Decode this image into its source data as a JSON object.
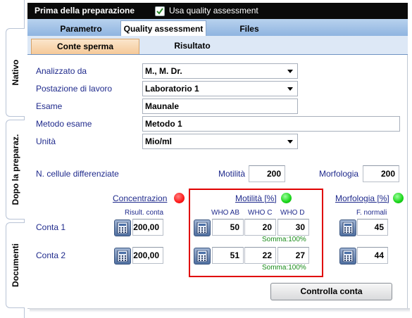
{
  "side_tabs": [
    "Nativo",
    "Dopo la preparaz.",
    "Documenti"
  ],
  "header": {
    "title": "Prima della preparazione",
    "quality_checkbox_label": "Usa quality assessment",
    "quality_checked": true
  },
  "tabs": [
    "Parametro",
    "Quality assessment",
    "Files"
  ],
  "active_tab": "Quality assessment",
  "subtabs": [
    "Conte sperma",
    "Risultato"
  ],
  "active_subtab": "Conte sperma",
  "form": {
    "analizzato_da": {
      "label": "Analizzato da",
      "value": "M., M. Dr."
    },
    "postazione": {
      "label": "Postazione di lavoro",
      "value": "Laboratorio 1"
    },
    "esame": {
      "label": "Esame",
      "value": "Maunale"
    },
    "metodo": {
      "label": "Metodo esame",
      "value": "Metodo 1"
    },
    "unita": {
      "label": "Unità",
      "value": "Mio/ml"
    }
  },
  "cells": {
    "label": "N. cellule differenziate",
    "motilita_label": "Motilità",
    "motilita_value": "200",
    "morfologia_label": "Morfologia",
    "morfologia_value": "200"
  },
  "sections": {
    "concentrazione": {
      "title": "Concentrazion",
      "status_color": "#ff1a1a",
      "col_header": "Risult. conta"
    },
    "motilita": {
      "title": "Motilità [%]",
      "status_color": "#19d619",
      "col_headers": [
        "WHO AB",
        "WHO C",
        "WHO D"
      ]
    },
    "morfologia": {
      "title": "Morfologia [%]",
      "status_color": "#19d619",
      "col_header": "F. normali"
    }
  },
  "rows": [
    {
      "label": "Conta 1",
      "concentrazione": "200,00",
      "motilita": [
        "50",
        "20",
        "30"
      ],
      "somma": "Somma:100%",
      "morfologia": "45"
    },
    {
      "label": "Conta 2",
      "concentrazione": "200,00",
      "motilita": [
        "51",
        "22",
        "27"
      ],
      "somma": "Somma:100%",
      "morfologia": "44"
    }
  ],
  "button": {
    "label": "Controlla conta"
  },
  "icons": {
    "checkbox": "checkmark-icon",
    "calculator": "calculator-icon",
    "dropdown": "chevron-down-icon"
  }
}
